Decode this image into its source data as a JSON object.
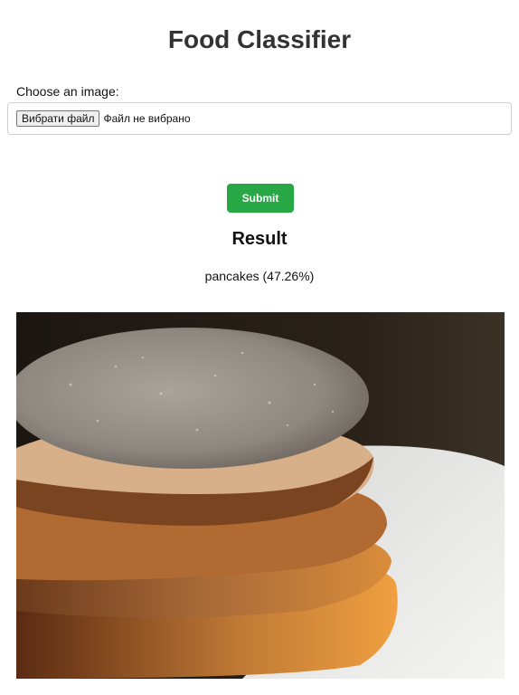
{
  "header": {
    "title": "Food Classifier"
  },
  "form": {
    "label": "Choose an image:",
    "file_button_label": "Вибрати файл",
    "file_status": "Файл не вибрано",
    "submit_label": "Submit"
  },
  "result": {
    "heading": "Result",
    "prediction": "pancakes (47.26%)",
    "image_subject": "pancake-stack-photo"
  },
  "colors": {
    "submit_button": "#28a745",
    "title": "#333333"
  }
}
